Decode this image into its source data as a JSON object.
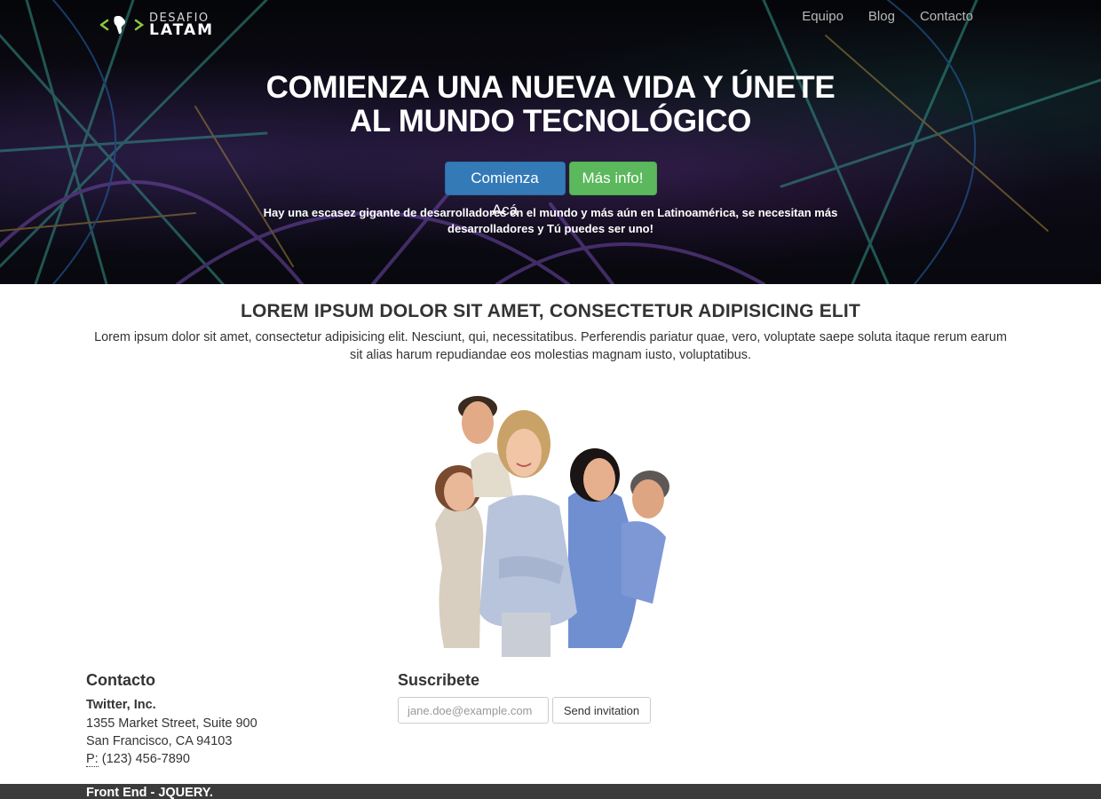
{
  "brand": {
    "top": "DESAFIO",
    "bottom": "LATAM",
    "mark": "<•>",
    "accent": "#8cc63f"
  },
  "nav": {
    "items": [
      "Equipo",
      "Blog",
      "Contacto"
    ]
  },
  "hero": {
    "title_line1": "COMIENZA UNA NUEVA VIDA Y ÚNETE",
    "title_line2": "AL MUNDO TECNOLÓGICO",
    "primary_button": "Comienza Acá",
    "secondary_button": "Más info!",
    "text": "Hay una escasez gigante de desarrolladores en el mundo y más aún en Latinoamérica, se necesitan más desarrolladores y Tú puedes ser uno!"
  },
  "about": {
    "title": "LOREM IPSUM DOLOR SIT AMET, CONSECTETUR ADIPISICING ELIT",
    "text": "Lorem ipsum dolor sit amet, consectetur adipisicing elit. Nesciunt, qui, necessitatibus. Perferendis pariatur quae, vero, voluptate saepe soluta itaque rerum earum sit alias harum repudiandae eos molestias magnam iusto, voluptatibus."
  },
  "contact": {
    "title": "Contacto",
    "company": "Twitter, Inc.",
    "street": "1355 Market Street, Suite 900",
    "city": "San Francisco, CA 94103",
    "phone_label": "P:",
    "phone": "(123) 456-7890"
  },
  "subscribe": {
    "title": "Suscribete",
    "placeholder": "jane.doe@example.com",
    "button": "Send invitation"
  },
  "footer": {
    "text": "Front End - JQUERY."
  },
  "colors": {
    "primary": "#337ab7",
    "success": "#5cb85c",
    "footer_bg": "#3b3b3b"
  }
}
